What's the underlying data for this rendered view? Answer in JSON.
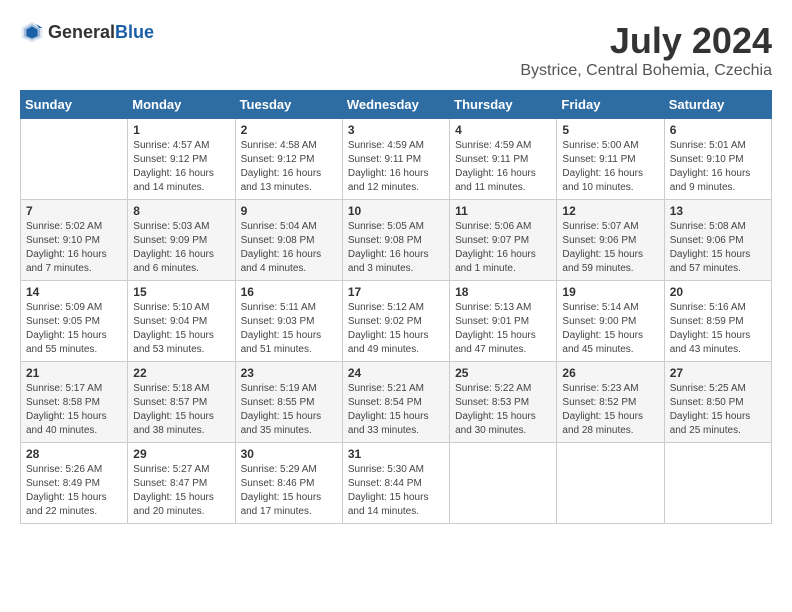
{
  "header": {
    "logo_general": "General",
    "logo_blue": "Blue",
    "month_title": "July 2024",
    "subtitle": "Bystrice, Central Bohemia, Czechia"
  },
  "days_of_week": [
    "Sunday",
    "Monday",
    "Tuesday",
    "Wednesday",
    "Thursday",
    "Friday",
    "Saturday"
  ],
  "weeks": [
    [
      {
        "day": "",
        "info": ""
      },
      {
        "day": "1",
        "info": "Sunrise: 4:57 AM\nSunset: 9:12 PM\nDaylight: 16 hours\nand 14 minutes."
      },
      {
        "day": "2",
        "info": "Sunrise: 4:58 AM\nSunset: 9:12 PM\nDaylight: 16 hours\nand 13 minutes."
      },
      {
        "day": "3",
        "info": "Sunrise: 4:59 AM\nSunset: 9:11 PM\nDaylight: 16 hours\nand 12 minutes."
      },
      {
        "day": "4",
        "info": "Sunrise: 4:59 AM\nSunset: 9:11 PM\nDaylight: 16 hours\nand 11 minutes."
      },
      {
        "day": "5",
        "info": "Sunrise: 5:00 AM\nSunset: 9:11 PM\nDaylight: 16 hours\nand 10 minutes."
      },
      {
        "day": "6",
        "info": "Sunrise: 5:01 AM\nSunset: 9:10 PM\nDaylight: 16 hours\nand 9 minutes."
      }
    ],
    [
      {
        "day": "7",
        "info": "Sunrise: 5:02 AM\nSunset: 9:10 PM\nDaylight: 16 hours\nand 7 minutes."
      },
      {
        "day": "8",
        "info": "Sunrise: 5:03 AM\nSunset: 9:09 PM\nDaylight: 16 hours\nand 6 minutes."
      },
      {
        "day": "9",
        "info": "Sunrise: 5:04 AM\nSunset: 9:08 PM\nDaylight: 16 hours\nand 4 minutes."
      },
      {
        "day": "10",
        "info": "Sunrise: 5:05 AM\nSunset: 9:08 PM\nDaylight: 16 hours\nand 3 minutes."
      },
      {
        "day": "11",
        "info": "Sunrise: 5:06 AM\nSunset: 9:07 PM\nDaylight: 16 hours\nand 1 minute."
      },
      {
        "day": "12",
        "info": "Sunrise: 5:07 AM\nSunset: 9:06 PM\nDaylight: 15 hours\nand 59 minutes."
      },
      {
        "day": "13",
        "info": "Sunrise: 5:08 AM\nSunset: 9:06 PM\nDaylight: 15 hours\nand 57 minutes."
      }
    ],
    [
      {
        "day": "14",
        "info": "Sunrise: 5:09 AM\nSunset: 9:05 PM\nDaylight: 15 hours\nand 55 minutes."
      },
      {
        "day": "15",
        "info": "Sunrise: 5:10 AM\nSunset: 9:04 PM\nDaylight: 15 hours\nand 53 minutes."
      },
      {
        "day": "16",
        "info": "Sunrise: 5:11 AM\nSunset: 9:03 PM\nDaylight: 15 hours\nand 51 minutes."
      },
      {
        "day": "17",
        "info": "Sunrise: 5:12 AM\nSunset: 9:02 PM\nDaylight: 15 hours\nand 49 minutes."
      },
      {
        "day": "18",
        "info": "Sunrise: 5:13 AM\nSunset: 9:01 PM\nDaylight: 15 hours\nand 47 minutes."
      },
      {
        "day": "19",
        "info": "Sunrise: 5:14 AM\nSunset: 9:00 PM\nDaylight: 15 hours\nand 45 minutes."
      },
      {
        "day": "20",
        "info": "Sunrise: 5:16 AM\nSunset: 8:59 PM\nDaylight: 15 hours\nand 43 minutes."
      }
    ],
    [
      {
        "day": "21",
        "info": "Sunrise: 5:17 AM\nSunset: 8:58 PM\nDaylight: 15 hours\nand 40 minutes."
      },
      {
        "day": "22",
        "info": "Sunrise: 5:18 AM\nSunset: 8:57 PM\nDaylight: 15 hours\nand 38 minutes."
      },
      {
        "day": "23",
        "info": "Sunrise: 5:19 AM\nSunset: 8:55 PM\nDaylight: 15 hours\nand 35 minutes."
      },
      {
        "day": "24",
        "info": "Sunrise: 5:21 AM\nSunset: 8:54 PM\nDaylight: 15 hours\nand 33 minutes."
      },
      {
        "day": "25",
        "info": "Sunrise: 5:22 AM\nSunset: 8:53 PM\nDaylight: 15 hours\nand 30 minutes."
      },
      {
        "day": "26",
        "info": "Sunrise: 5:23 AM\nSunset: 8:52 PM\nDaylight: 15 hours\nand 28 minutes."
      },
      {
        "day": "27",
        "info": "Sunrise: 5:25 AM\nSunset: 8:50 PM\nDaylight: 15 hours\nand 25 minutes."
      }
    ],
    [
      {
        "day": "28",
        "info": "Sunrise: 5:26 AM\nSunset: 8:49 PM\nDaylight: 15 hours\nand 22 minutes."
      },
      {
        "day": "29",
        "info": "Sunrise: 5:27 AM\nSunset: 8:47 PM\nDaylight: 15 hours\nand 20 minutes."
      },
      {
        "day": "30",
        "info": "Sunrise: 5:29 AM\nSunset: 8:46 PM\nDaylight: 15 hours\nand 17 minutes."
      },
      {
        "day": "31",
        "info": "Sunrise: 5:30 AM\nSunset: 8:44 PM\nDaylight: 15 hours\nand 14 minutes."
      },
      {
        "day": "",
        "info": ""
      },
      {
        "day": "",
        "info": ""
      },
      {
        "day": "",
        "info": ""
      }
    ]
  ]
}
